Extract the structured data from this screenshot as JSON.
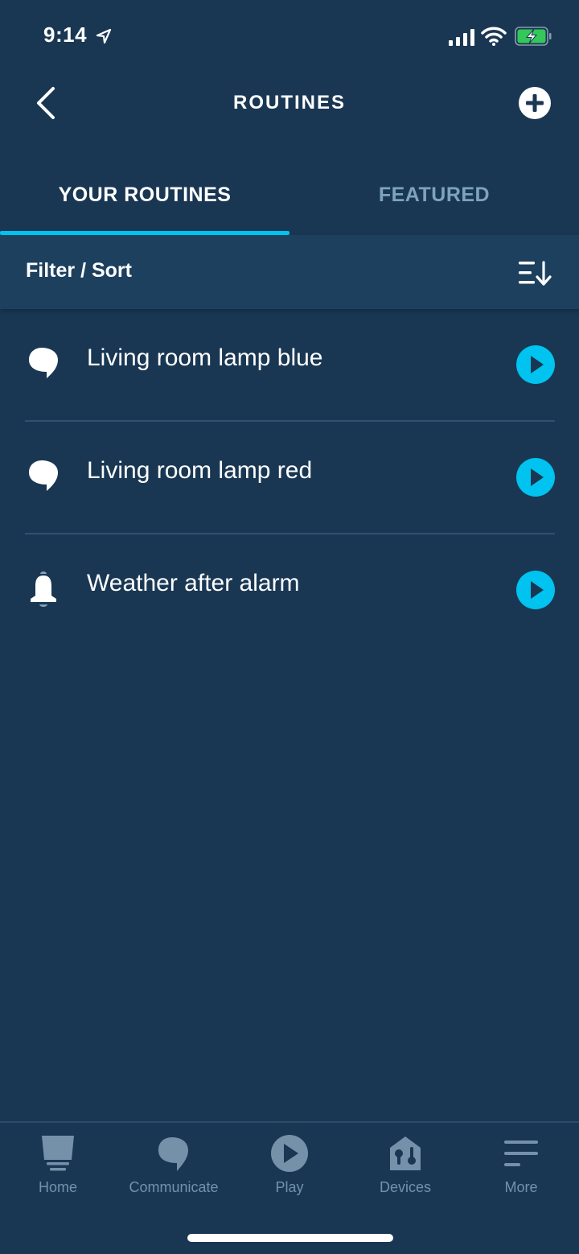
{
  "status_bar": {
    "time": "9:14",
    "icons": [
      "location-arrow-icon",
      "signal-icon",
      "wifi-icon",
      "battery-charging-icon"
    ]
  },
  "header": {
    "title": "ROUTINES",
    "back_icon": "chevron-left-icon",
    "add_icon": "plus-circle-icon"
  },
  "tabs": [
    {
      "label": "YOUR ROUTINES",
      "active": true
    },
    {
      "label": "FEATURED",
      "active": false
    }
  ],
  "filter_bar": {
    "label": "Filter / Sort",
    "icon": "sort-icon"
  },
  "routines": [
    {
      "name": "Living room lamp blue",
      "icon": "speech-bubble-icon"
    },
    {
      "name": "Living room lamp red",
      "icon": "speech-bubble-icon"
    },
    {
      "name": "Weather after alarm",
      "icon": "bell-icon"
    }
  ],
  "bottom_nav": [
    {
      "label": "Home",
      "icon": "home-icon"
    },
    {
      "label": "Communicate",
      "icon": "communicate-icon"
    },
    {
      "label": "Play",
      "icon": "play-icon"
    },
    {
      "label": "Devices",
      "icon": "devices-icon"
    },
    {
      "label": "More",
      "icon": "more-icon"
    }
  ],
  "colors": {
    "background": "#193753",
    "filter_bar": "#1d405f",
    "accent": "#00c3ef",
    "inactive_tab": "#7ea3bd",
    "nav_inactive": "#7591aa",
    "battery": "#34c759"
  }
}
